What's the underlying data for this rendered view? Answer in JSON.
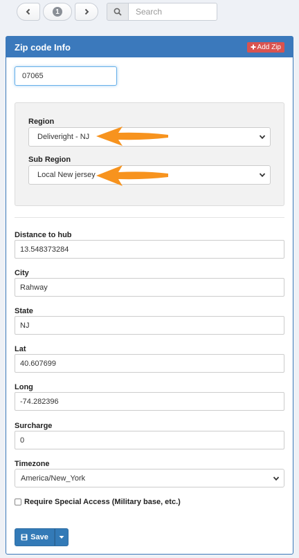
{
  "pager": {
    "page": "1"
  },
  "search": {
    "placeholder": "Search"
  },
  "panel": {
    "title": "Zip code Info",
    "add_button": "Add Zip",
    "zip_value": "07065",
    "region": {
      "label": "Region",
      "value": "Deliveright - NJ"
    },
    "sub_region": {
      "label": "Sub Region",
      "value": "Local New jersey"
    },
    "fields": [
      {
        "label": "Distance to hub",
        "value": "13.548373284"
      },
      {
        "label": "City",
        "value": "Rahway"
      },
      {
        "label": "State",
        "value": "NJ"
      },
      {
        "label": "Lat",
        "value": "40.607699"
      },
      {
        "label": "Long",
        "value": "-74.282396"
      },
      {
        "label": "Surcharge",
        "value": "0"
      }
    ],
    "timezone": {
      "label": "Timezone",
      "value": "America/New_York"
    },
    "special_access": "Require Special Access (Military base, etc.)",
    "save_label": "Save"
  },
  "colors": {
    "header": "#3b79bc",
    "add_button": "#d9534f",
    "save_button": "#337ab7",
    "annotation_arrow": "#f7931e"
  }
}
